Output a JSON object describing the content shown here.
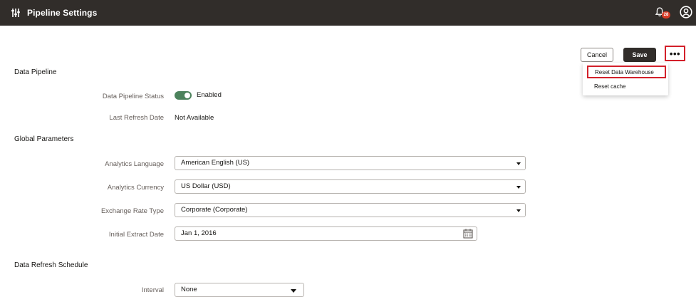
{
  "header": {
    "title": "Pipeline Settings",
    "settings_icon": "sliders-icon",
    "notification_icon": "bell-icon",
    "notification_count": "28",
    "avatar_icon": "user-avatar-icon"
  },
  "toolbar": {
    "cancel_label": "Cancel",
    "save_label": "Save",
    "more_label": "•••"
  },
  "menu": {
    "items": [
      {
        "label": "Reset Data Warehouse"
      },
      {
        "label": "Reset cache"
      }
    ]
  },
  "data_pipeline": {
    "section_title": "Data Pipeline",
    "status_label": "Data Pipeline Status",
    "status_value": "Enabled",
    "refresh_label": "Last Refresh Date",
    "refresh_value": "Not Available"
  },
  "global_parameters": {
    "section_title": "Global Parameters",
    "language_label": "Analytics Language",
    "language_value": "American English (US)",
    "currency_label": "Analytics Currency",
    "currency_value": "US Dollar (USD)",
    "exchange_label": "Exchange Rate Type",
    "exchange_value": "Corporate (Corporate)",
    "extract_label": "Initial Extract Date",
    "extract_value": "Jan 1, 2016"
  },
  "schedule": {
    "section_title": "Data Refresh Schedule",
    "interval_label": "Interval",
    "interval_value": "None"
  },
  "colors": {
    "header_bg": "#312d2a",
    "toggle_on": "#4c825c",
    "highlight": "#d3202a",
    "badge": "#d63b25"
  }
}
